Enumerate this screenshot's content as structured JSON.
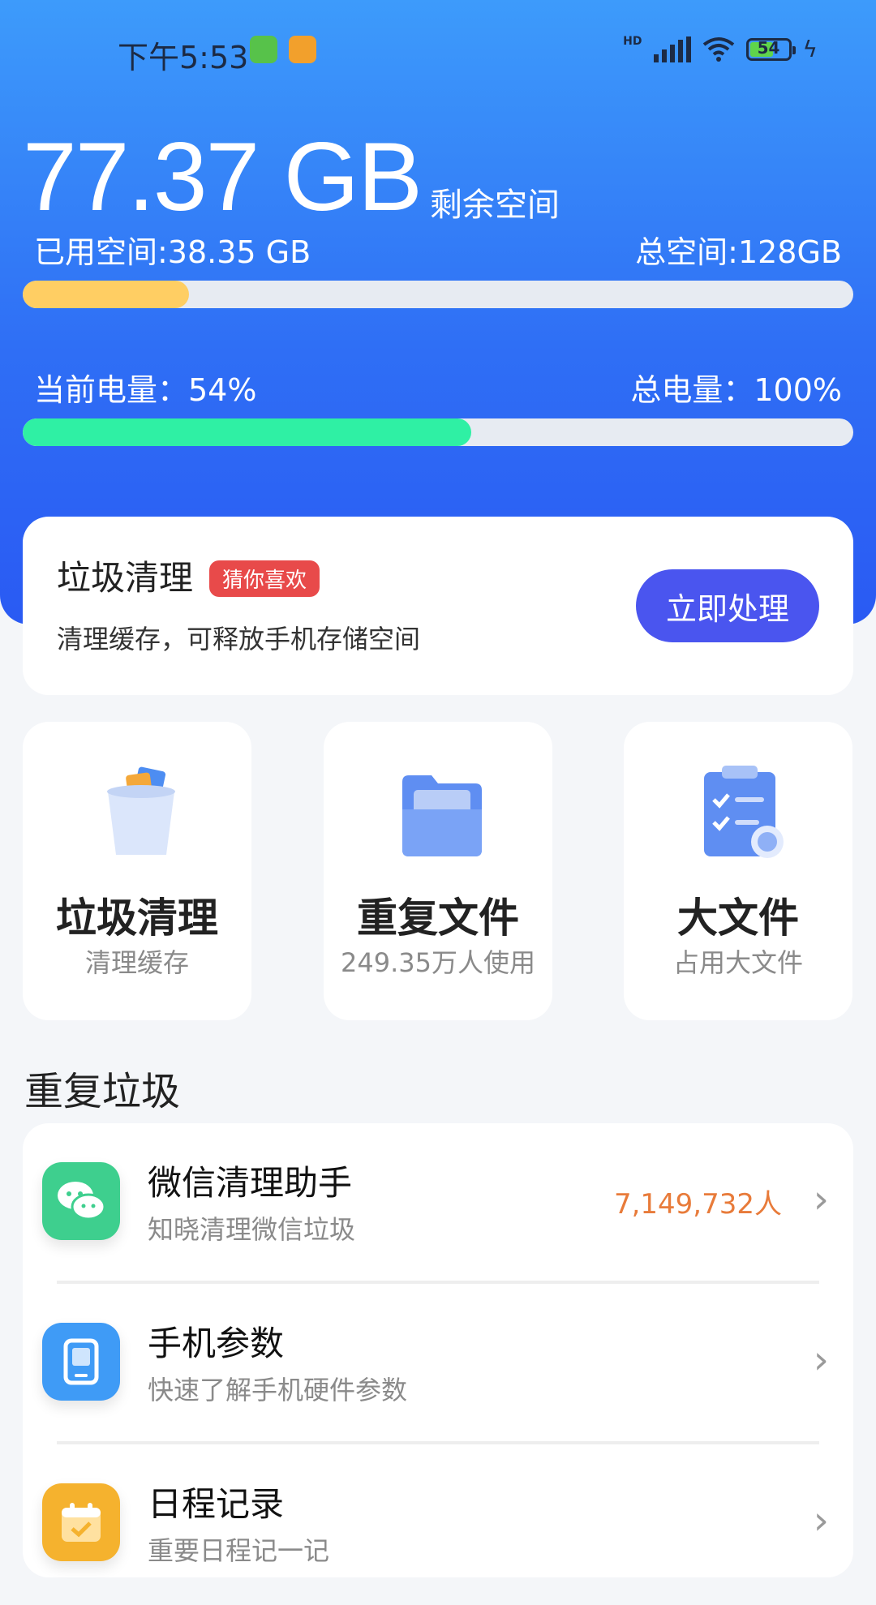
{
  "status_bar": {
    "time": "下午5:53",
    "network": "HD",
    "battery": "54",
    "icons": [
      "android-notification-icon",
      "gallery-notification-icon",
      "signal-icon",
      "wifi-icon",
      "battery-icon",
      "charging-icon"
    ]
  },
  "storage": {
    "remaining": "77.37 GB",
    "remaining_label": "剩余空间",
    "used": "已用空间:38.35 GB",
    "total": "总空间:128GB",
    "used_fraction": 0.2
  },
  "battery": {
    "current": "当前电量：54%",
    "total": "总电量：100%",
    "level_fraction": 0.54
  },
  "clean_card": {
    "title": "垃圾清理",
    "tag": "猜你喜欢",
    "subtitle": "清理缓存，可释放手机存储空间",
    "button": "立即处理"
  },
  "tiles": [
    {
      "title": "垃圾清理",
      "subtitle": "清理缓存",
      "icon": "trash-bin-icon"
    },
    {
      "title": "重复文件",
      "subtitle": "249.35万人使用",
      "icon": "folder-icon"
    },
    {
      "title": "大文件",
      "subtitle": "占用大文件",
      "icon": "clipboard-checklist-icon"
    }
  ],
  "section_title": "重复垃圾",
  "list": [
    {
      "name": "微信清理助手",
      "desc": "知晓清理微信垃圾",
      "count": "7,149,732人",
      "icon": "wechat-icon"
    },
    {
      "name": "手机参数",
      "desc": "快速了解手机硬件参数",
      "count": "",
      "icon": "phone-icon"
    },
    {
      "name": "日程记录",
      "desc": "重要日程记一记",
      "count": "",
      "icon": "calendar-icon"
    }
  ],
  "colors": {
    "accent_blue": "#2f6ff5",
    "button": "#4a55ef",
    "storage_bar": "#ffce63",
    "battery_bar": "#2ff0a4",
    "tag": "#e84a4a",
    "count": "#e87b3a"
  }
}
